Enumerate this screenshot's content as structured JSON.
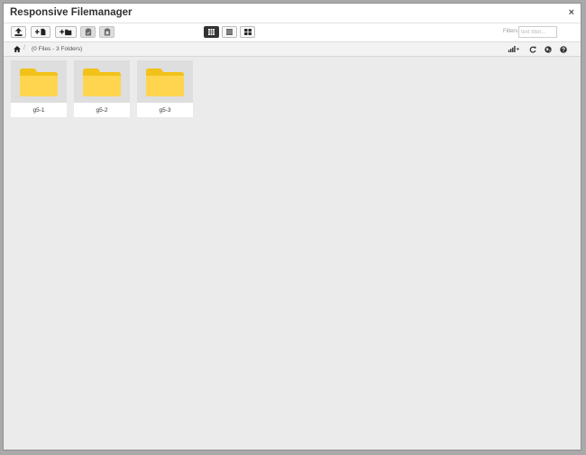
{
  "window": {
    "title": "Responsive Filemanager",
    "close_glyph": "×"
  },
  "toolbar": {
    "buttons": [
      {
        "name": "upload-button",
        "icon": "upload-icon",
        "state": "normal"
      },
      {
        "name": "new-file-button",
        "icon": "plus-file-icon",
        "state": "normal"
      },
      {
        "name": "new-folder-button",
        "icon": "plus-folder-icon",
        "state": "normal"
      },
      {
        "name": "paste-button",
        "icon": "clipboard-paste-icon",
        "state": "disabled"
      },
      {
        "name": "clear-clipboard-button",
        "icon": "clipboard-clear-icon",
        "state": "disabled"
      }
    ],
    "view_modes": [
      {
        "name": "view-boxes-button",
        "icon": "grid-icon",
        "active": true
      },
      {
        "name": "view-list-button",
        "icon": "list-icon",
        "active": false
      },
      {
        "name": "view-columns-button",
        "icon": "columns-icon",
        "active": false
      }
    ],
    "filter_label": "Filters:",
    "filter_placeholder": "text filter..."
  },
  "pathbar": {
    "separator": "/",
    "count_text": "(0 Files - 3 Folders)",
    "icons": [
      "sort-icon",
      "refresh-icon",
      "language-icon",
      "help-icon"
    ]
  },
  "folders": [
    {
      "label": "g5-1"
    },
    {
      "label": "g5-2"
    },
    {
      "label": "g5-3"
    }
  ],
  "colors": {
    "folder_front": "#ffd54f",
    "folder_back": "#f2c21a",
    "active_button": "#333333"
  }
}
